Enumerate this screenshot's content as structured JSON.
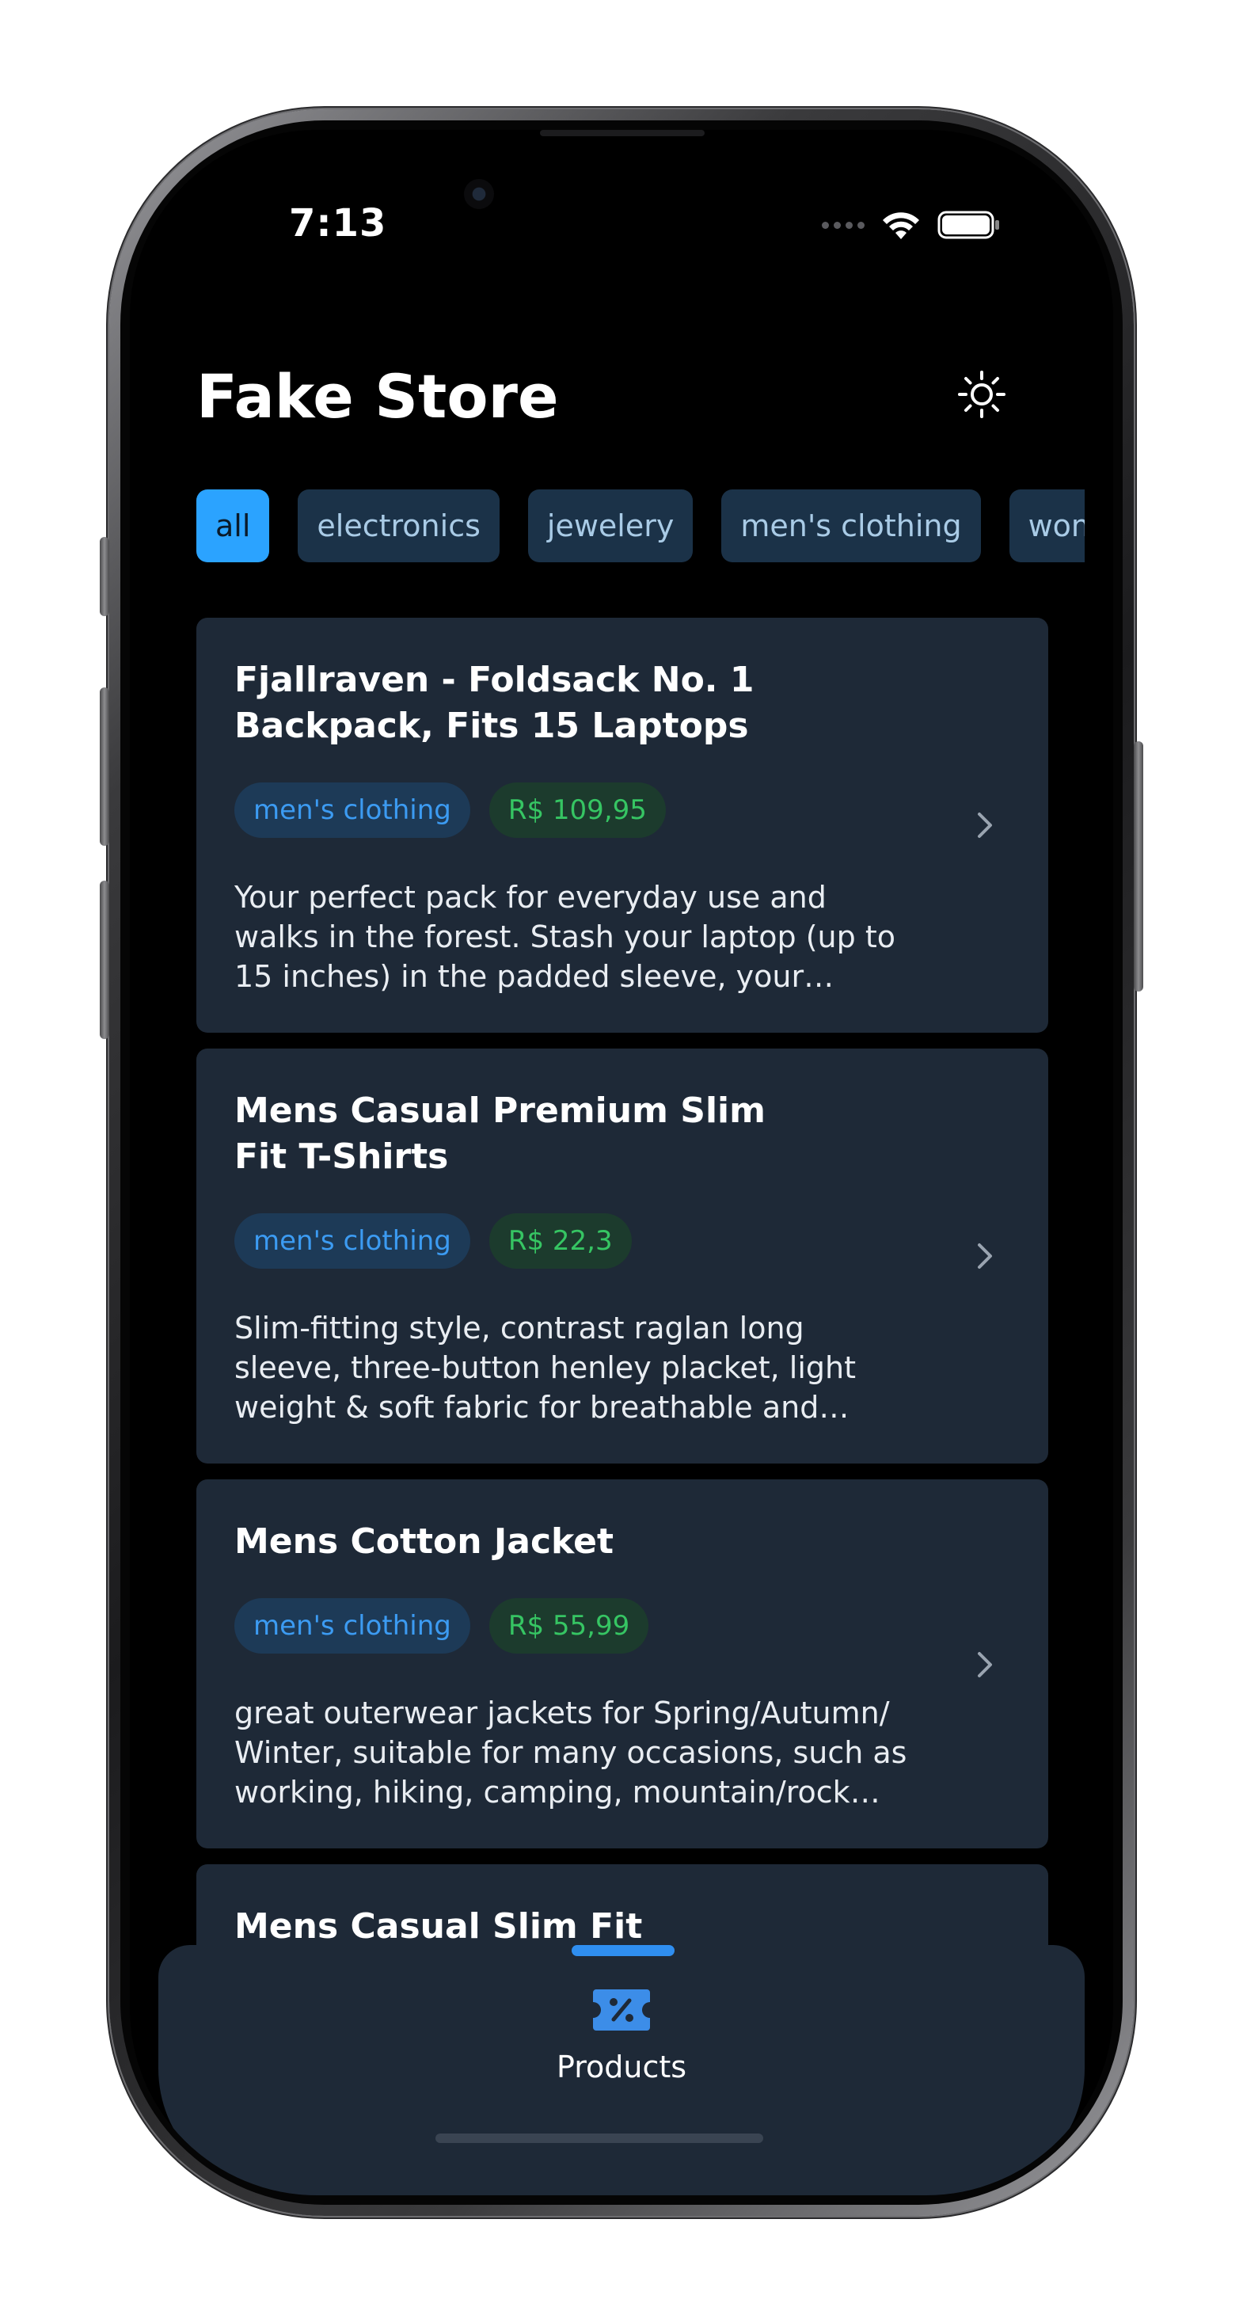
{
  "status_bar": {
    "time": "7:13"
  },
  "header": {
    "title": "Fake Store"
  },
  "categories": [
    {
      "label": "all",
      "active": true
    },
    {
      "label": "electronics",
      "active": false
    },
    {
      "label": "jewelery",
      "active": false
    },
    {
      "label": "men's clothing",
      "active": false
    },
    {
      "label": "women's clothing",
      "active": false
    }
  ],
  "products": [
    {
      "title": "Fjallraven - Foldsack No. 1 Backpack, Fits 15 Laptops",
      "category": "men's clothing",
      "price": "R$ 109,95",
      "description": "Your perfect pack for everyday use and walks in the forest. Stash your laptop (up to 15 inches) in the padded sleeve, your every..."
    },
    {
      "title": "Mens Casual Premium Slim Fit T-Shirts",
      "category": "men's clothing",
      "price": "R$ 22,3",
      "description": "Slim-fitting style, contrast raglan long sleeve, three-button henley placket, light weight & soft fabric for breathable and comfortable..."
    },
    {
      "title": "Mens Cotton Jacket",
      "category": "men's clothing",
      "price": "R$ 55,99",
      "description": "great outerwear jackets for Spring/Autumn/ Winter, suitable for many occasions, such as working, hiking, camping, mountain/rock cli..."
    },
    {
      "title": "Mens Casual Slim Fit"
    }
  ],
  "tabbar": {
    "items": [
      {
        "label": "Products",
        "icon": "ticket-percent-icon",
        "active": true
      }
    ]
  },
  "colors": {
    "background": "#000000",
    "card": "#1e2937",
    "accent": "#2ba3ff",
    "category_tag_text": "#3c9bf2",
    "price_tag_text": "#36c563"
  }
}
